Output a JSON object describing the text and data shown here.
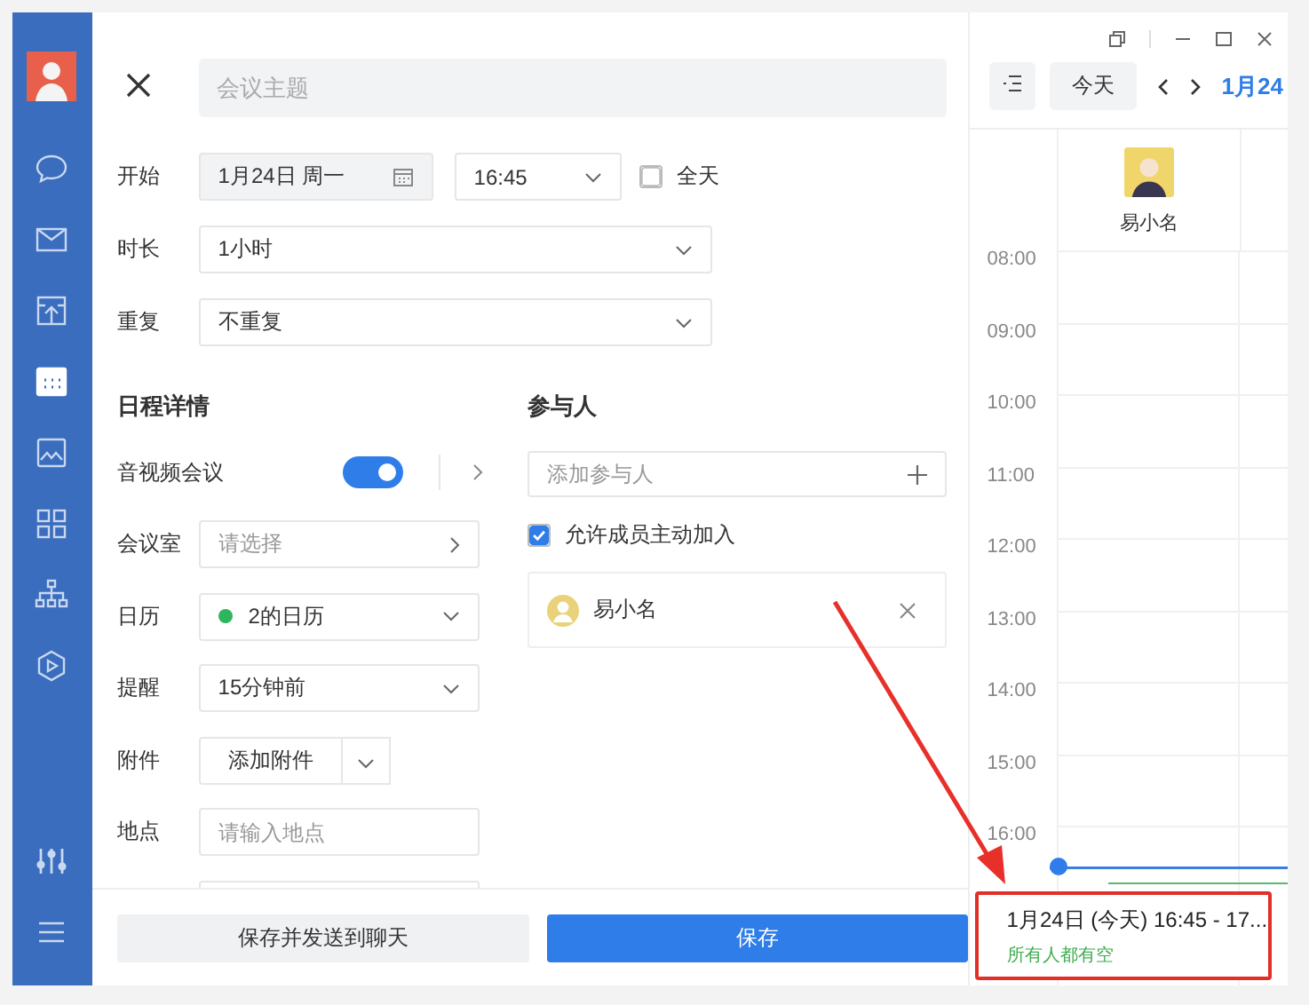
{
  "sidebar": {
    "items": [
      {
        "selected": false
      },
      {
        "selected": false
      },
      {
        "selected": false
      },
      {
        "selected": true
      },
      {
        "selected": false
      },
      {
        "selected": false
      },
      {
        "selected": false
      },
      {
        "selected": false
      }
    ]
  },
  "form": {
    "title_placeholder": "会议主题",
    "start": {
      "label": "开始",
      "date": "1月24日 周一",
      "time": "16:45",
      "all_day": {
        "label": "全天",
        "checked": false
      }
    },
    "duration": {
      "label": "时长",
      "value": "1小时"
    },
    "repeat": {
      "label": "重复",
      "value": "不重复"
    },
    "details": {
      "heading": "日程详情",
      "video": {
        "label": "音视频会议",
        "on": true
      },
      "room": {
        "label": "会议室",
        "placeholder": "请选择"
      },
      "calendar": {
        "label": "日历",
        "value": "2的日历",
        "color": "#2fb65d"
      },
      "reminder": {
        "label": "提醒",
        "value": "15分钟前"
      },
      "attachment": {
        "label": "附件",
        "button": "添加附件"
      },
      "location": {
        "label": "地点",
        "placeholder": "请输入地点"
      }
    },
    "participants": {
      "heading": "参与人",
      "add_placeholder": "添加参与人",
      "allow_join": {
        "label": "允许成员主动加入",
        "checked": true
      },
      "people": [
        {
          "name": "易小名"
        }
      ]
    }
  },
  "footer": {
    "buttons": [
      "保存并发送到聊天",
      "保存"
    ]
  },
  "calendar": {
    "today": "今天",
    "date_title": "1月24",
    "person": "易小名",
    "hours": [
      "08:00",
      "09:00",
      "10:00",
      "11:00",
      "12:00",
      "13:00",
      "14:00",
      "15:00",
      "16:00"
    ],
    "popup": {
      "time": "1月24日 (今天) 16:45 - 17...",
      "status": "所有人都有空"
    }
  }
}
